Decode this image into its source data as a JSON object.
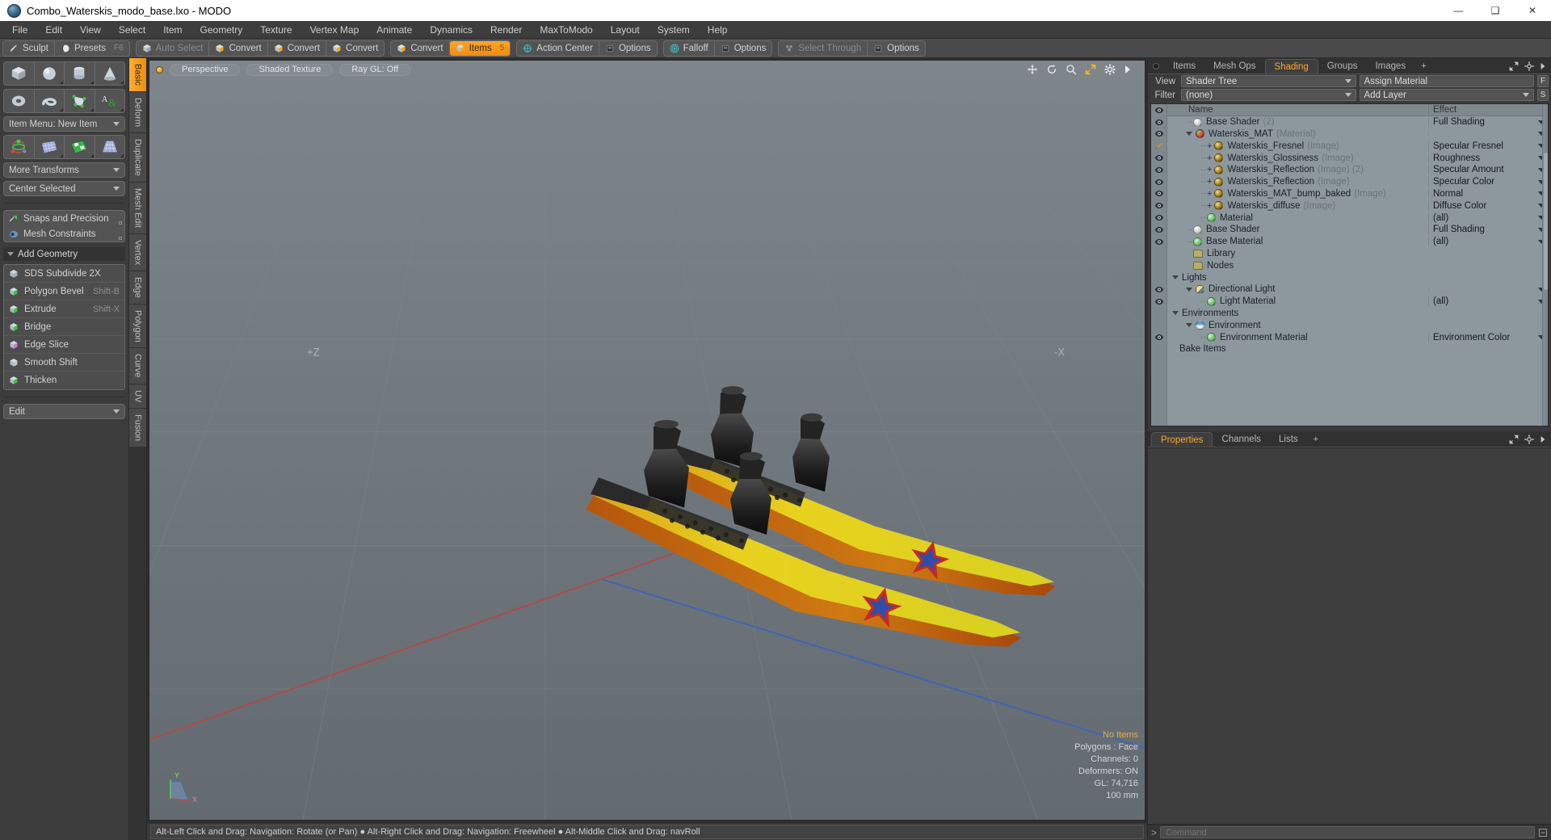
{
  "window": {
    "title": "Combo_Waterskis_modo_base.lxo - MODO",
    "minimize": "—",
    "maximize": "❑",
    "close": "✕"
  },
  "menubar": [
    "File",
    "Edit",
    "View",
    "Select",
    "Item",
    "Geometry",
    "Texture",
    "Vertex Map",
    "Animate",
    "Dynamics",
    "Render",
    "MaxToModo",
    "Layout",
    "System",
    "Help"
  ],
  "toolbar": {
    "groups": [
      {
        "buttons": [
          {
            "label": "Sculpt",
            "icon": "brush-icon",
            "state": "normal",
            "hotkey": ""
          },
          {
            "label": "Presets",
            "icon": "sphere-icon",
            "state": "normal",
            "hotkey": "F6"
          }
        ]
      },
      {
        "buttons": [
          {
            "label": "Auto Select",
            "icon": "cube-icon",
            "state": "dim",
            "hotkey": ""
          },
          {
            "label": "Convert",
            "icon": "cube-vertex-icon",
            "state": "normal",
            "hotkey": ""
          },
          {
            "label": "Convert",
            "icon": "cube-edge-icon",
            "state": "normal",
            "hotkey": ""
          },
          {
            "label": "Convert",
            "icon": "cube-polygon-icon",
            "state": "normal",
            "hotkey": ""
          }
        ]
      },
      {
        "buttons": [
          {
            "label": "Convert",
            "icon": "cube-material-icon",
            "state": "normal",
            "hotkey": ""
          },
          {
            "label": "Items",
            "icon": "cube-item-icon",
            "state": "active",
            "hotkey": "5"
          }
        ]
      },
      {
        "buttons": [
          {
            "label": "Action Center",
            "icon": "action-center-icon",
            "state": "normal",
            "hotkey": ""
          },
          {
            "label": "Options",
            "icon": "options-icon",
            "state": "normal",
            "hotkey": ""
          }
        ]
      },
      {
        "buttons": [
          {
            "label": "Falloff",
            "icon": "falloff-icon",
            "state": "normal",
            "hotkey": ""
          },
          {
            "label": "Options",
            "icon": "options-icon",
            "state": "normal",
            "hotkey": ""
          }
        ]
      },
      {
        "buttons": [
          {
            "label": "Select Through",
            "icon": "select-through-icon",
            "state": "dim",
            "hotkey": ""
          },
          {
            "label": "Options",
            "icon": "options-icon",
            "state": "normal",
            "hotkey": ""
          }
        ]
      }
    ]
  },
  "left_panel": {
    "primitives_row1": [
      "cube-icon",
      "sphere-icon",
      "cylinder-icon",
      "cone-icon"
    ],
    "primitives_row2": [
      "torus-icon",
      "spiral-icon",
      "polygon-pen-icon",
      "text-icon"
    ],
    "item_menu": "Item Menu: New Item",
    "tools_row": [
      "transform-gizmo-icon",
      "mesh-grid-icon",
      "checker-plane-icon",
      "lattice-icon"
    ],
    "more_transforms": "More Transforms",
    "center_selected": "Center Selected",
    "snaps": "Snaps and Precision",
    "mesh_constraints": "Mesh Constraints",
    "add_geometry_header": "Add Geometry",
    "geometry_items": [
      {
        "label": "SDS Subdivide 2X",
        "key": "",
        "icon": "sds-icon"
      },
      {
        "label": "Polygon Bevel",
        "key": "Shift-B",
        "icon": "bevel-icon"
      },
      {
        "label": "Extrude",
        "key": "Shift-X",
        "icon": "extrude-icon"
      },
      {
        "label": "Bridge",
        "key": "",
        "icon": "bridge-icon"
      },
      {
        "label": "Edge Slice",
        "key": "",
        "icon": "edge-slice-icon"
      },
      {
        "label": "Smooth Shift",
        "key": "",
        "icon": "smooth-shift-icon"
      },
      {
        "label": "Thicken",
        "key": "",
        "icon": "thicken-icon"
      }
    ],
    "edit_dropdown": "Edit"
  },
  "vertical_tabs": [
    {
      "label": "Basic",
      "active": true
    },
    {
      "label": "Deform",
      "active": false
    },
    {
      "label": "Duplicate",
      "active": false
    },
    {
      "label": "Mesh Edit",
      "active": false
    },
    {
      "label": "Vertex",
      "active": false
    },
    {
      "label": "Edge",
      "active": false
    },
    {
      "label": "Polygon",
      "active": false
    },
    {
      "label": "Curve",
      "active": false
    },
    {
      "label": "UV",
      "active": false
    },
    {
      "label": "Fusion",
      "active": false
    }
  ],
  "viewport": {
    "pills": [
      "Perspective",
      "Shaded Texture",
      "Ray GL: Off"
    ],
    "icons": [
      "move-icon",
      "rotate-icon",
      "zoom-icon",
      "fit-icon",
      "gear-icon",
      "play-icon"
    ],
    "stats": {
      "selection": "No Items",
      "polygons": "Polygons : Face",
      "channels": "Channels: 0",
      "deformers": "Deformers: ON",
      "gl": "GL: 74,716",
      "scale": "100 mm"
    },
    "axis_labels": {
      "plus_z": "+Z",
      "minus_x": "-X",
      "gizmo_y": "Y",
      "gizmo_x": "X"
    }
  },
  "hint_bar": "Alt-Left Click and Drag: Navigation: Rotate (or Pan)  ●  Alt-Right Click and Drag: Navigation: Freewheel  ●  Alt-Middle Click and Drag: navRoll",
  "right_panel": {
    "tabs": [
      {
        "label": "Items",
        "active": false
      },
      {
        "label": "Mesh Ops",
        "active": false
      },
      {
        "label": "Shading",
        "active": true
      },
      {
        "label": "Groups",
        "active": false
      },
      {
        "label": "Images",
        "active": false
      },
      {
        "label": "+",
        "active": false
      }
    ],
    "view_label": "View",
    "view_value": "Shader Tree",
    "assign_material": "Assign Material",
    "assign_button": "F",
    "filter_label": "Filter",
    "filter_value": "(none)",
    "add_layer": "Add Layer",
    "add_layer_button": "S",
    "columns": {
      "name": "Name",
      "effect": "Effect"
    },
    "tree": [
      {
        "indent": 1,
        "twist": "stub",
        "icon": "sphere-white",
        "name": "Base Shader",
        "suffix": "(2)",
        "effect": "Full Shading",
        "eye": "eye",
        "has_plus": false
      },
      {
        "indent": 1,
        "twist": "open",
        "icon": "sphere-red",
        "name": "Waterskis_MAT",
        "suffix": "(Material)",
        "effect": "",
        "eye": "eye",
        "has_plus": false
      },
      {
        "indent": 2,
        "twist": "stub",
        "icon": "sphere-gold",
        "name": "Waterskis_Fresnel",
        "suffix": "(Image)",
        "effect": "Specular Fresnel",
        "eye": "brush",
        "has_plus": true
      },
      {
        "indent": 2,
        "twist": "stub",
        "icon": "sphere-gold",
        "name": "Waterskis_Glossiness",
        "suffix": "(Image)",
        "effect": "Roughness",
        "eye": "eye",
        "has_plus": true
      },
      {
        "indent": 2,
        "twist": "stub",
        "icon": "sphere-gold",
        "name": "Waterskis_Reflection",
        "suffix": "(Image) (2)",
        "effect": "Specular Amount",
        "eye": "eye",
        "has_plus": true
      },
      {
        "indent": 2,
        "twist": "stub",
        "icon": "sphere-gold",
        "name": "Waterskis_Reflection",
        "suffix": "(Image)",
        "effect": "Specular Color",
        "eye": "eye",
        "has_plus": true
      },
      {
        "indent": 2,
        "twist": "stub",
        "icon": "sphere-gold",
        "name": "Waterskis_MAT_bump_baked",
        "suffix": "(Image)",
        "effect": "Normal",
        "eye": "eye",
        "has_plus": true
      },
      {
        "indent": 2,
        "twist": "stub",
        "icon": "sphere-gold",
        "name": "Waterskis_diffuse",
        "suffix": "(Image)",
        "effect": "Diffuse Color",
        "eye": "eye",
        "has_plus": true
      },
      {
        "indent": 2,
        "twist": "stub",
        "icon": "sphere-green",
        "name": "Material",
        "suffix": "",
        "effect": "(all)",
        "eye": "eye",
        "has_plus": false
      },
      {
        "indent": 1,
        "twist": "stub",
        "icon": "sphere-white",
        "name": "Base Shader",
        "suffix": "",
        "effect": "Full Shading",
        "eye": "eye",
        "has_plus": false
      },
      {
        "indent": 1,
        "twist": "stub",
        "icon": "sphere-green",
        "name": "Base Material",
        "suffix": "",
        "effect": "(all)",
        "eye": "eye",
        "has_plus": false
      },
      {
        "indent": 1,
        "twist": "none",
        "icon": "folder",
        "name": "Library",
        "suffix": "",
        "effect": "",
        "eye": "",
        "has_plus": false
      },
      {
        "indent": 1,
        "twist": "none",
        "icon": "folder",
        "name": "Nodes",
        "suffix": "",
        "effect": "",
        "eye": "",
        "has_plus": false
      },
      {
        "indent": 0,
        "twist": "open",
        "icon": "none",
        "name": "Lights",
        "suffix": "",
        "effect": "",
        "eye": "",
        "has_plus": false
      },
      {
        "indent": 1,
        "twist": "open",
        "icon": "light",
        "name": "Directional Light",
        "suffix": "",
        "effect": "",
        "eye": "eye",
        "has_plus": false
      },
      {
        "indent": 2,
        "twist": "stub",
        "icon": "sphere-green",
        "name": "Light Material",
        "suffix": "",
        "effect": "(all)",
        "eye": "eye",
        "has_plus": false
      },
      {
        "indent": 0,
        "twist": "open",
        "icon": "none",
        "name": "Environments",
        "suffix": "",
        "effect": "",
        "eye": "",
        "has_plus": false
      },
      {
        "indent": 1,
        "twist": "open",
        "icon": "env",
        "name": "Environment",
        "suffix": "",
        "effect": "",
        "eye": "",
        "has_plus": false
      },
      {
        "indent": 2,
        "twist": "stub",
        "icon": "sphere-green",
        "name": "Environment Material",
        "suffix": "",
        "effect": "Environment Color",
        "eye": "eye",
        "has_plus": false
      },
      {
        "indent": 0,
        "twist": "none",
        "icon": "none",
        "name": "Bake Items",
        "suffix": "",
        "effect": "",
        "eye": "",
        "has_plus": false
      }
    ],
    "bottom_tabs": [
      {
        "label": "Properties",
        "active": true
      },
      {
        "label": "Channels",
        "active": false
      },
      {
        "label": "Lists",
        "active": false
      },
      {
        "label": "+",
        "active": false
      }
    ],
    "command_placeholder": "Command"
  },
  "colors": {
    "accent": "#ffa82b",
    "titlebar_bg": "#ffffff",
    "panel_bg": "#3a3a3a",
    "tree_bg": "#8d979e",
    "viewport_top": "#7a8288"
  }
}
